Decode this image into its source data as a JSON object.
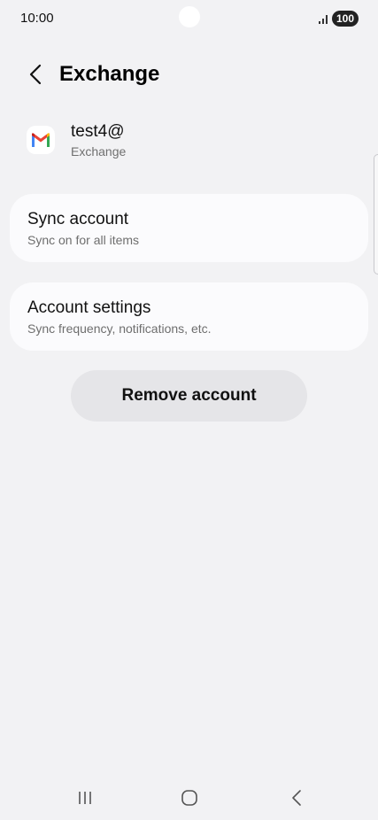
{
  "status_bar": {
    "time": "10:00",
    "battery": "100"
  },
  "header": {
    "title": "Exchange"
  },
  "account": {
    "email": "test4@",
    "type": "Exchange"
  },
  "cards": [
    {
      "title": "Sync account",
      "subtitle": "Sync on for all items"
    },
    {
      "title": "Account settings",
      "subtitle": "Sync frequency, notifications, etc."
    }
  ],
  "remove_button": {
    "label": "Remove account"
  },
  "icons": {
    "back": "back-arrow-icon",
    "signal": "signal-icon",
    "gmail": "gmail-icon",
    "recents": "recents-icon",
    "home": "home-icon",
    "nav_back": "nav-back-icon"
  },
  "colors": {
    "background": "#f2f2f4",
    "card": "#fbfbfd",
    "button": "#e5e5e8"
  }
}
